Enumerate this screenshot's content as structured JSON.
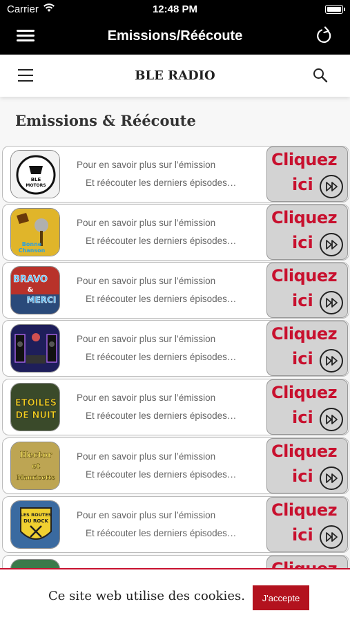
{
  "status": {
    "carrier": "Carrier",
    "time": "12:48 PM"
  },
  "nav": {
    "title": "Emissions/Réécoute"
  },
  "header": {
    "brand": "BLE RADIO"
  },
  "page": {
    "title": "Emissions & Réécoute"
  },
  "cards": [
    {
      "line1": "Pour en savoir plus sur l’émission",
      "line2": "Et réécouter les derniers épisodes…",
      "cta1": "Cliquez",
      "cta2": "ici",
      "thumb_label": "BLE MOTORS",
      "thumb_bg": "#f2f2f2",
      "thumb_fg": "#111"
    },
    {
      "line1": "Pour en savoir plus sur l’émission",
      "line2": "Et réécouter les derniers épisodes…",
      "cta1": "Cliquez",
      "cta2": "ici",
      "thumb_label": "",
      "thumb_bg": "#e0b52a",
      "thumb_fg": "#5a3a0a"
    },
    {
      "line1": "Pour en savoir plus sur l’émission",
      "line2": "Et réécouter les derniers épisodes…",
      "cta1": "Cliquez",
      "cta2": "ici",
      "thumb_label": "BRAVO & MERCI",
      "thumb_bg": "#b8322a",
      "thumb_fg": "#4fb0e6"
    },
    {
      "line1": "Pour en savoir plus sur l’émission",
      "line2": "Et réécouter les derniers épisodes…",
      "cta1": "Cliquez",
      "cta2": "ici",
      "thumb_label": "",
      "thumb_bg": "#2a2a6a",
      "thumb_fg": "#a060e0"
    },
    {
      "line1": "Pour en savoir plus sur l’émission",
      "line2": "Et réécouter les derniers épisodes…",
      "cta1": "Cliquez",
      "cta2": "ici",
      "thumb_label": "ETOILES DE NUIT",
      "thumb_bg": "#3a4a2a",
      "thumb_fg": "#f0d020"
    },
    {
      "line1": "Pour en savoir plus sur l’émission",
      "line2": "Et réécouter les derniers épisodes…",
      "cta1": "Cliquez",
      "cta2": "ici",
      "thumb_label": "Hector et Mauricette",
      "thumb_bg": "#b8a040",
      "thumb_fg": "#f4e060"
    },
    {
      "line1": "Pour en savoir plus sur l’émission",
      "line2": "Et réécouter les derniers épisodes…",
      "cta1": "Cliquez",
      "cta2": "ici",
      "thumb_label": "LES ROUTES DU ROCK",
      "thumb_bg": "#3a6aa0",
      "thumb_fg": "#f0d030"
    },
    {
      "line1": "",
      "line2": "",
      "cta1": "Cliquez",
      "cta2": "",
      "thumb_label": "",
      "thumb_bg": "#3a7a4a",
      "thumb_fg": "#fff"
    }
  ],
  "cookie": {
    "message": "Ce site web utilise des cookies.",
    "accept": "J'accepte"
  },
  "colors": {
    "accent_red": "#c8102e",
    "cta_bg": "#d3d3d3",
    "bar_bg": "#000000"
  }
}
